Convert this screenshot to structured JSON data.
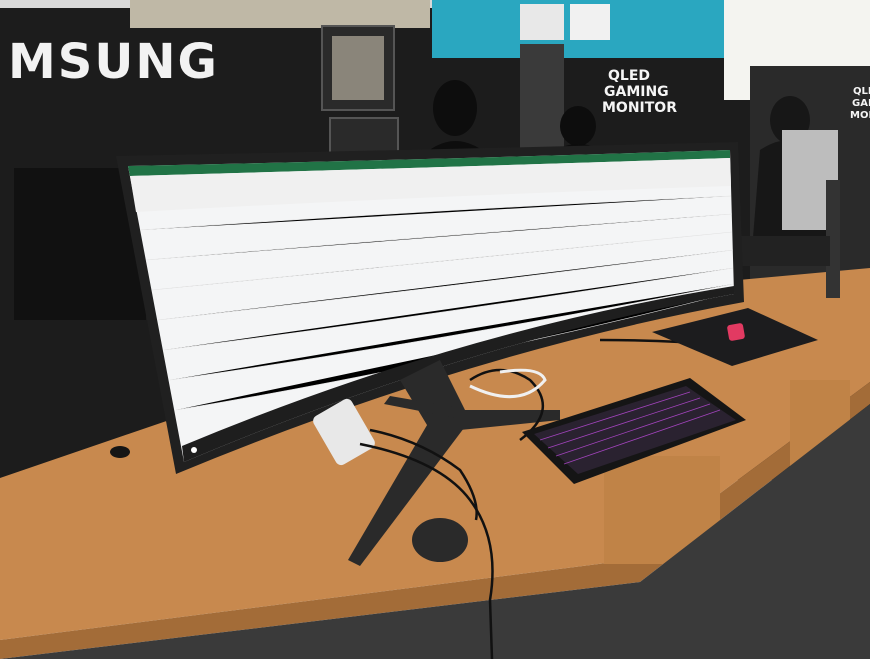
{
  "signage": {
    "brand_wall": "MSUNG",
    "promo_main": [
      "QLED",
      "GAMING",
      "MONITOR"
    ],
    "promo_side": [
      "QLED",
      "GAMING",
      "MONITOR"
    ]
  },
  "colors": {
    "wall": "#1c1c1c",
    "desk": "#c8894e",
    "monitor_bezel": "#202020",
    "excel_green": "#217346",
    "laptop_accent": "#e23a62",
    "keyboard_backlight": "#c04ce0"
  }
}
